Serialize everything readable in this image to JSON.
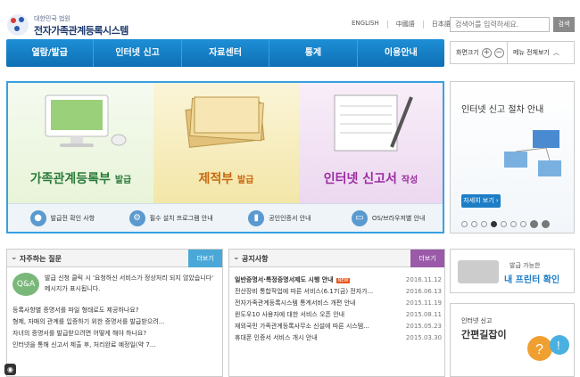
{
  "header": {
    "logo_small": "대한민국 법원",
    "logo_title": "전자가족관계등록시스템",
    "languages": [
      "ENGLISH",
      "中國語",
      "日本語"
    ],
    "search_placeholder": "검색어를 입력하세요.",
    "search_button": "검색"
  },
  "nav": {
    "items": [
      "열람/발급",
      "인터넷 신고",
      "자료센터",
      "통계",
      "이용안내"
    ]
  },
  "tools": {
    "zoom_label": "화면크기",
    "zoom_in": "+",
    "zoom_out": "−",
    "menu_all": "메뉴 전체보기"
  },
  "hero": {
    "panels": [
      {
        "main": "가족관계등록부",
        "sub": "발급"
      },
      {
        "main": "제적부",
        "sub": "발급"
      },
      {
        "main": "인터넷 신고서",
        "sub": "작성"
      }
    ],
    "quick_links": [
      "발급전 확인 사항",
      "필수 설치 프로그램 안내",
      "공인인증서 안내",
      "OS/브라우저별 안내"
    ]
  },
  "side_banner": {
    "title": "인터넷 신고 절차 안내",
    "button": "자세히 보기 ›"
  },
  "faq": {
    "title": "자주하는 질문",
    "more": "더보기",
    "top_text": "발급 신청 클릭 시 '요청하신 서비스가 정상처리 되지 않았습니다' 메시지가 표시됩니다.",
    "items": [
      "등록사항별 증명서를 파일 형태로도 제공하나요?",
      "형제, 자매의 관계를 입증하기 위한 증명서를 발급받으려...",
      "자녀의 증명서를 발급받으려면 어떻게 해야 하나요?",
      "인터넷을 통해 신고서 제출 후, 처리완료 예정일(약 7..."
    ]
  },
  "notice": {
    "title": "공지사항",
    "more": "더보기",
    "items": [
      {
        "text": "일반증명서·특정증명서제도 시행 안내",
        "date": "2016.11.12",
        "badge": "NEW"
      },
      {
        "text": "전산장비 통합작업에 따른 서비스(6.17(금) 전자가...",
        "date": "2016.06.13"
      },
      {
        "text": "전자가족관계등록시스템 통계서비스 개편 안내",
        "date": "2015.11.19"
      },
      {
        "text": "윈도우10 사용자에 대한 서비스 오픈 안내",
        "date": "2015.08.11"
      },
      {
        "text": "재외국민 가족관계등록사무소 신설에 따른 시스템...",
        "date": "2015.05.23"
      },
      {
        "text": "휴대폰 인증서 서비스 개시 안내",
        "date": "2015.03.30"
      }
    ]
  },
  "banner_printer": {
    "line1": "발급 가능한",
    "line2": "내 프린터 확인"
  },
  "banner_guide": {
    "line1": "인터넷 신고",
    "line2": "간편길잡이"
  }
}
